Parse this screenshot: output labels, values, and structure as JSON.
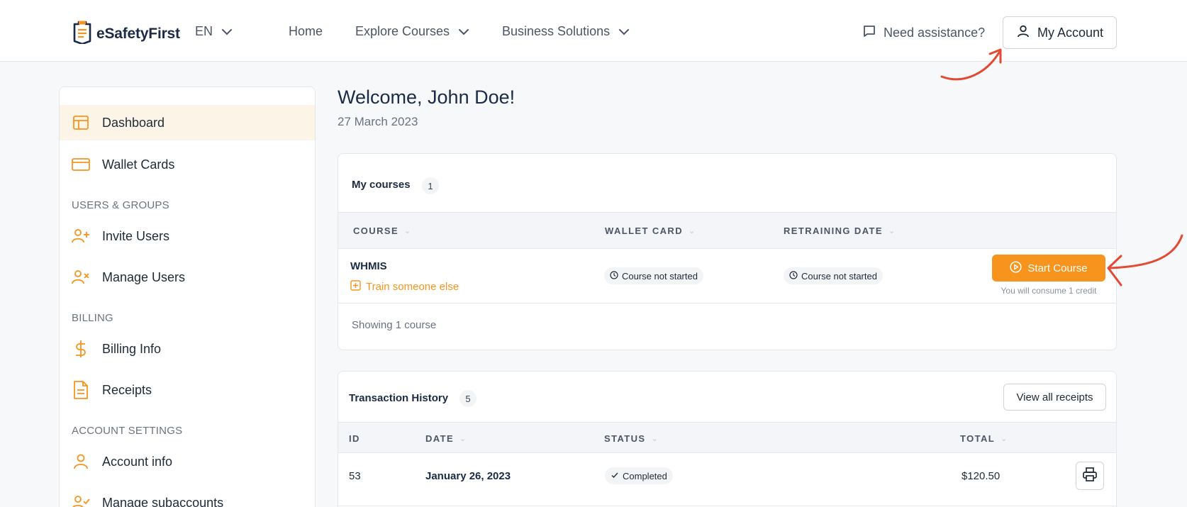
{
  "brand": {
    "name": "eSafetyFirst",
    "accent": "#f7941d"
  },
  "header": {
    "language": "EN",
    "nav": [
      {
        "label": "Home"
      },
      {
        "label": "Explore Courses"
      },
      {
        "label": "Business Solutions"
      }
    ],
    "assistance": "Need assistance?",
    "account": "My Account"
  },
  "sidebar": {
    "items": [
      {
        "label": "Dashboard",
        "icon": "layout-icon"
      },
      {
        "label": "Wallet Cards",
        "icon": "credit-card-icon"
      },
      {
        "label": "Invite Users",
        "icon": "user-plus-icon"
      },
      {
        "label": "Manage Users",
        "icon": "user-x-icon"
      },
      {
        "label": "Billing Info",
        "icon": "dollar-icon"
      },
      {
        "label": "Receipts",
        "icon": "document-icon"
      },
      {
        "label": "Account info",
        "icon": "user-icon"
      },
      {
        "label": "Manage subaccounts",
        "icon": "user-check-icon"
      }
    ],
    "sections": {
      "users": "USERS & GROUPS",
      "billing": "BILLING",
      "settings": "ACCOUNT SETTINGS"
    }
  },
  "main": {
    "welcome": "Welcome, John Doe!",
    "date": "27 March 2023",
    "courses": {
      "title": "My courses",
      "count": "1",
      "columns": [
        "COURSE",
        "WALLET CARD",
        "RETRAINING DATE"
      ],
      "rows": [
        {
          "course": "WHMIS",
          "train_link": "Train someone else",
          "wallet_card": "Course not started",
          "retraining_date": "Course not started",
          "action": "Start Course",
          "credit_note": "You will consume 1 credit"
        }
      ],
      "footer": "Showing 1 course"
    },
    "transactions": {
      "title": "Transaction History",
      "count": "5",
      "view_all": "View all receipts",
      "columns": [
        "ID",
        "DATE",
        "STATUS",
        "TOTAL"
      ],
      "rows": [
        {
          "id": "53",
          "date": "January 26, 2023",
          "status": "Completed",
          "total": "$120.50"
        }
      ]
    }
  }
}
